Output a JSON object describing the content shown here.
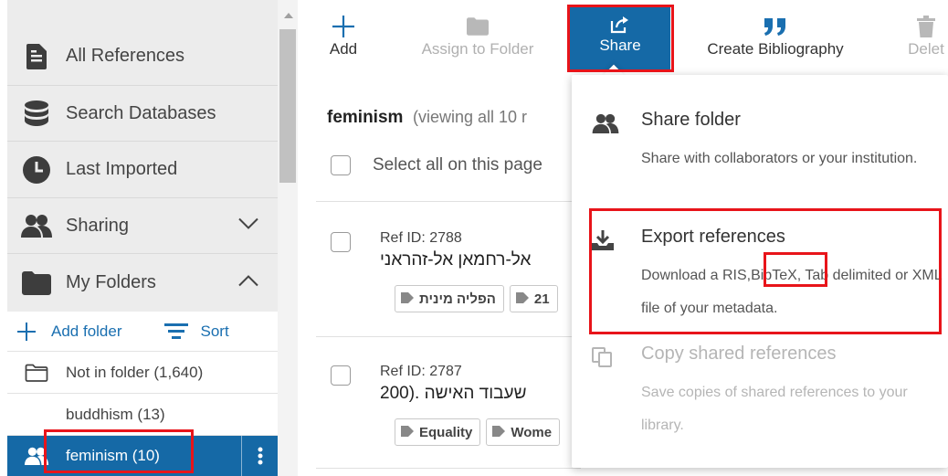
{
  "sidebar": {
    "nav": [
      {
        "label": "All References",
        "icon": "document-icon"
      },
      {
        "label": "Search Databases",
        "icon": "database-icon"
      },
      {
        "label": "Last Imported",
        "icon": "clock-icon"
      },
      {
        "label": "Sharing",
        "icon": "users-icon"
      },
      {
        "label": "My Folders",
        "icon": "folder-icon"
      }
    ],
    "add_folder_label": "Add folder",
    "sort_label": "Sort",
    "folders": [
      {
        "label": "Not in folder (1,640)"
      },
      {
        "label": "buddhism (13)"
      },
      {
        "label": "feminism (10)"
      }
    ]
  },
  "toolbar": {
    "add_label": "Add",
    "assign_label": "Assign to Folder",
    "share_label": "Share",
    "bibliography_label": "Create Bibliography",
    "delete_label": "Delet"
  },
  "main": {
    "folder_name": "feminism",
    "viewing_text": "(viewing all 10 r",
    "select_all_label": "Select all on this page",
    "references": [
      {
        "ref_id": "Ref ID: 2788",
        "title": "אל-רחמאן אל-זהראני",
        "tags": [
          "הפליה מינית",
          "21"
        ]
      },
      {
        "ref_id": "Ref ID: 2787",
        "title": "שעבוד האישה .(200",
        "tags": [
          "Equality",
          "Wome"
        ]
      }
    ]
  },
  "share_menu": {
    "items": [
      {
        "title": "Share folder",
        "description": "Share with collaborators or your institution."
      },
      {
        "title": "Export references",
        "description_pre": "Download a RIS,",
        "description_highlight": "BibTeX",
        "description_post": ", Tab delimited or XML file of your metadata."
      },
      {
        "title": "Copy shared references",
        "description": "Save copies of shared references to your library."
      }
    ]
  },
  "colors": {
    "accent_blue": "#1569a6",
    "link_blue": "#1a6fb0",
    "highlight_red": "#e8141a",
    "sidebar_bg": "#ececec"
  }
}
